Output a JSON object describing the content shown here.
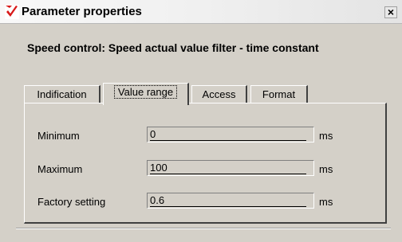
{
  "window": {
    "title": "Parameter properties",
    "close_label": "×"
  },
  "dialog": {
    "heading": "Speed control: Speed actual value filter - time constant"
  },
  "tabs": [
    {
      "label": "Indification",
      "active": false
    },
    {
      "label": "Value range",
      "active": true
    },
    {
      "label": "Access",
      "active": false
    },
    {
      "label": "Format",
      "active": false
    }
  ],
  "fields": [
    {
      "label": "Minimum",
      "value": "0",
      "unit": "ms"
    },
    {
      "label": "Maximum",
      "value": "100",
      "unit": "ms"
    },
    {
      "label": "Factory setting",
      "value": "0.6",
      "unit": "ms"
    }
  ],
  "colors": {
    "window_bg": "#d4d0c8",
    "icon_red": "#d81818"
  },
  "icons": {
    "app": "red-check-arrow-icon",
    "close": "close-icon"
  }
}
